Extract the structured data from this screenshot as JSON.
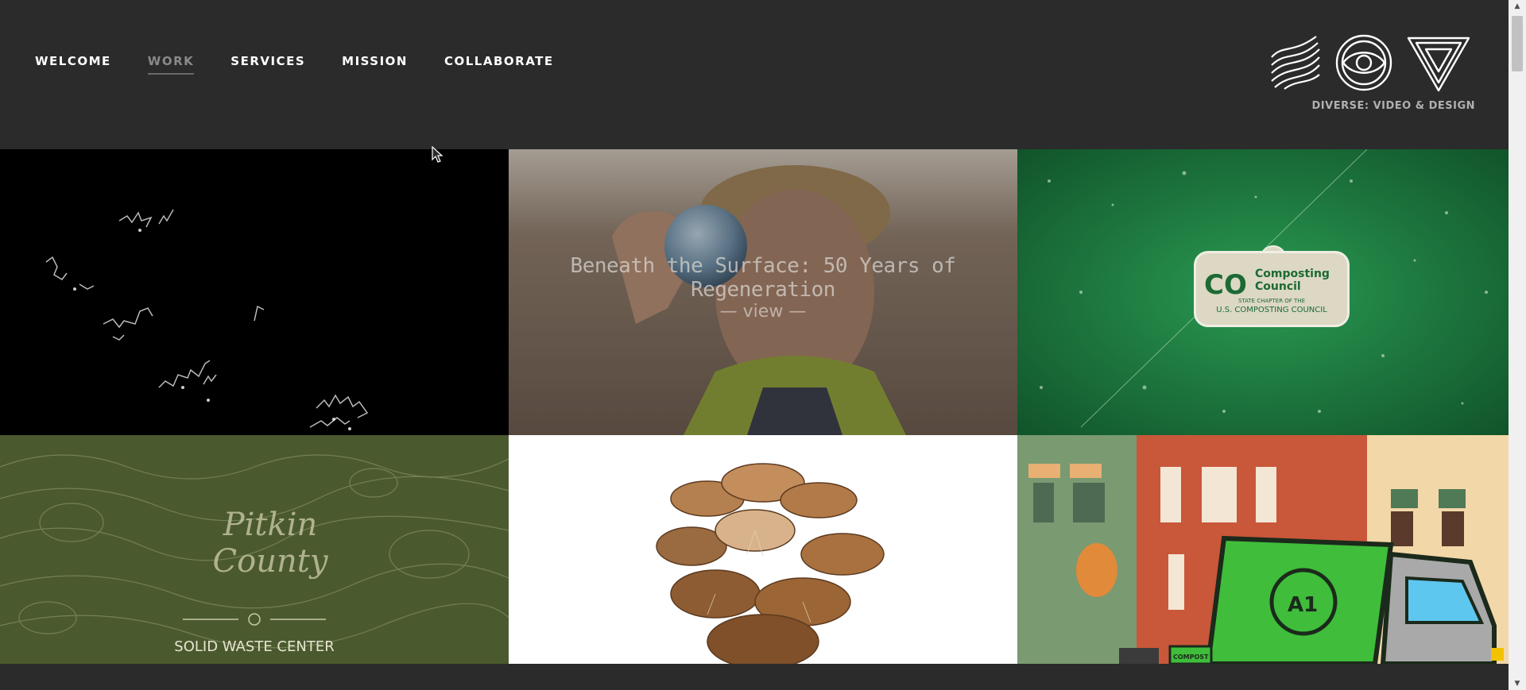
{
  "nav": {
    "items": [
      {
        "label": "WELCOME",
        "active": false
      },
      {
        "label": "WORK",
        "active": true
      },
      {
        "label": "SERVICES",
        "active": false
      },
      {
        "label": "MISSION",
        "active": false
      },
      {
        "label": "COLLABORATE",
        "active": false
      }
    ]
  },
  "brand": {
    "caption": "DIVERSE: VIDEO & DESIGN",
    "icons": [
      "wave-lines-icon",
      "eye-icon",
      "triangle-icon"
    ]
  },
  "tiles": [
    {
      "name": "tile-abstract-dark"
    },
    {
      "name": "tile-beneath-the-surface",
      "title": "Beneath the Surface: 50 Years of Regeneration",
      "view_label": "— view —"
    },
    {
      "name": "tile-colorado-composting",
      "badge_co": "CO",
      "badge_name_1": "Composting",
      "badge_name_2": "Council",
      "badge_state": "STATE CHAPTER OF THE",
      "badge_us": "U.S. COMPOSTING COUNCIL"
    },
    {
      "name": "tile-pitkin-county",
      "title_1": "Pitkin",
      "title_2": "County",
      "subtitle": "SOLID WASTE CENTER"
    },
    {
      "name": "tile-mushrooms"
    },
    {
      "name": "tile-a1-truck",
      "truck_label": "A1",
      "bin_label": "COMPOST"
    }
  ],
  "colors": {
    "background": "#2b2b2b",
    "nav_text": "#ffffff",
    "nav_active": "#8a8a8a",
    "caption": "#b0b0b0"
  }
}
